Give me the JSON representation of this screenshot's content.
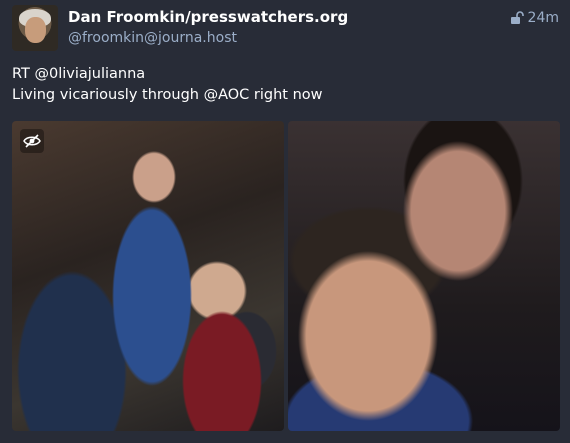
{
  "status": {
    "display_name": "Dan Froomkin/presswatchers.org",
    "account": "@froomkin@journa.host",
    "timestamp": "24m",
    "visibility_icon": "unlock-icon",
    "content_lines": [
      "RT @0liviajulianna",
      "Living vicariously through @AOC right now"
    ],
    "media": [
      {
        "icon": "eye-slash-icon"
      },
      {}
    ]
  },
  "colors": {
    "background": "#282c37",
    "secondary_text": "#9baec8",
    "primary_text": "#ffffff"
  }
}
